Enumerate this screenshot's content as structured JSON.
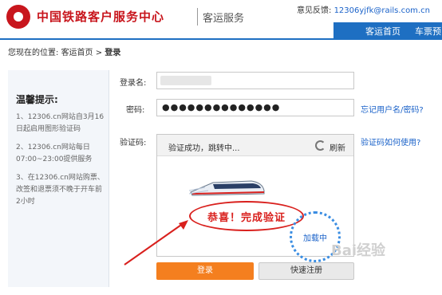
{
  "header": {
    "site_title": "中国铁路客户服务中心",
    "subtitle": "客运服务",
    "feedback_label": "意见反馈:",
    "feedback_email": "12306yjfk@rails.com.cn",
    "nav": [
      "客运首页",
      "车票预"
    ]
  },
  "breadcrumb": {
    "prefix": "您现在的位置:",
    "home": "客运首页",
    "sep": ">",
    "current": "登录"
  },
  "tips": {
    "title": "温馨提示:",
    "items": [
      "1、12306.cn网站自3月16日起启用图形验证码",
      "2、12306.cn网站每日07:00~23:00提供服务",
      "3、在12306.cn网站购票、改签和退票须不晚于开车前2小时"
    ]
  },
  "form": {
    "username_label": "登录名:",
    "password_label": "密码:",
    "password_value": "●●●●●●●●●●●●●●",
    "forgot_link": "忘记用户名/密码?",
    "captcha_label": "验证码:",
    "captcha_help_link": "验证码如何使用?",
    "captcha_message": "验证成功，跳转中...",
    "refresh_label": "刷新",
    "congrats_text": "恭喜！完成验证",
    "loading_text": "加载中"
  },
  "buttons": {
    "login": "登录",
    "register": "快速注册"
  },
  "watermark": "Bai经验",
  "colors": {
    "brand_red": "#c8161d",
    "nav_blue": "#1e6fc2",
    "login_orange": "#f47f1f",
    "link_blue": "#1a62c9"
  }
}
